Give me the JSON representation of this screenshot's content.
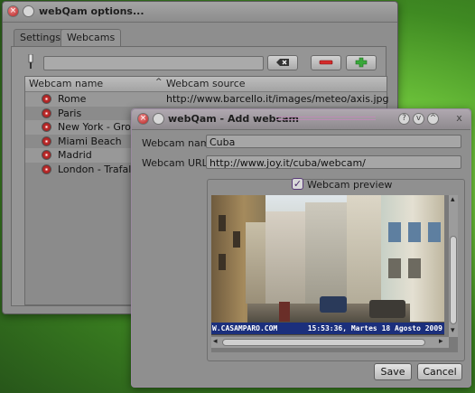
{
  "main_window": {
    "title": "webQam options...",
    "tabs": [
      "Settings",
      "Webcams"
    ],
    "active_tab": "Webcams",
    "list": {
      "columns": [
        "Webcam name",
        "Webcam source"
      ],
      "sort_indicator": "^",
      "rows": [
        {
          "name": "Rome",
          "source": "http://www.barcello.it/images/meteo/axis.jpg"
        },
        {
          "name": "Paris",
          "source": ""
        },
        {
          "name": "New York - Ground",
          "source": ""
        },
        {
          "name": "Miami Beach",
          "source": ""
        },
        {
          "name": "Madrid",
          "source": ""
        },
        {
          "name": "London - Trafalgar",
          "source": ""
        }
      ]
    },
    "toolbar_icons": [
      "broom-icon",
      "clear-icon",
      "remove-icon",
      "add-icon"
    ]
  },
  "dialog": {
    "title": "webQam - Add webcam",
    "name_label": "Webcam name",
    "name_value": "Cuba",
    "url_label": "Webcam URL",
    "url_value": "http://www.joy.it/cuba/webcam/",
    "preview_label": "Webcam preview",
    "preview_checked": true,
    "preview_caption_left": "W.CASAMPARO.COM",
    "preview_caption_right": "15:53:36, Martes 18 Agosto 2009",
    "save_label": "Save",
    "cancel_label": "Cancel",
    "title_buttons": [
      "?",
      "v",
      "^",
      "x"
    ]
  },
  "colors": {
    "desktop_green": "#6cc23a",
    "window_gray": "#8e8e8e",
    "caption_bar": "#1b2f7c",
    "camera_red": "#c83232"
  }
}
